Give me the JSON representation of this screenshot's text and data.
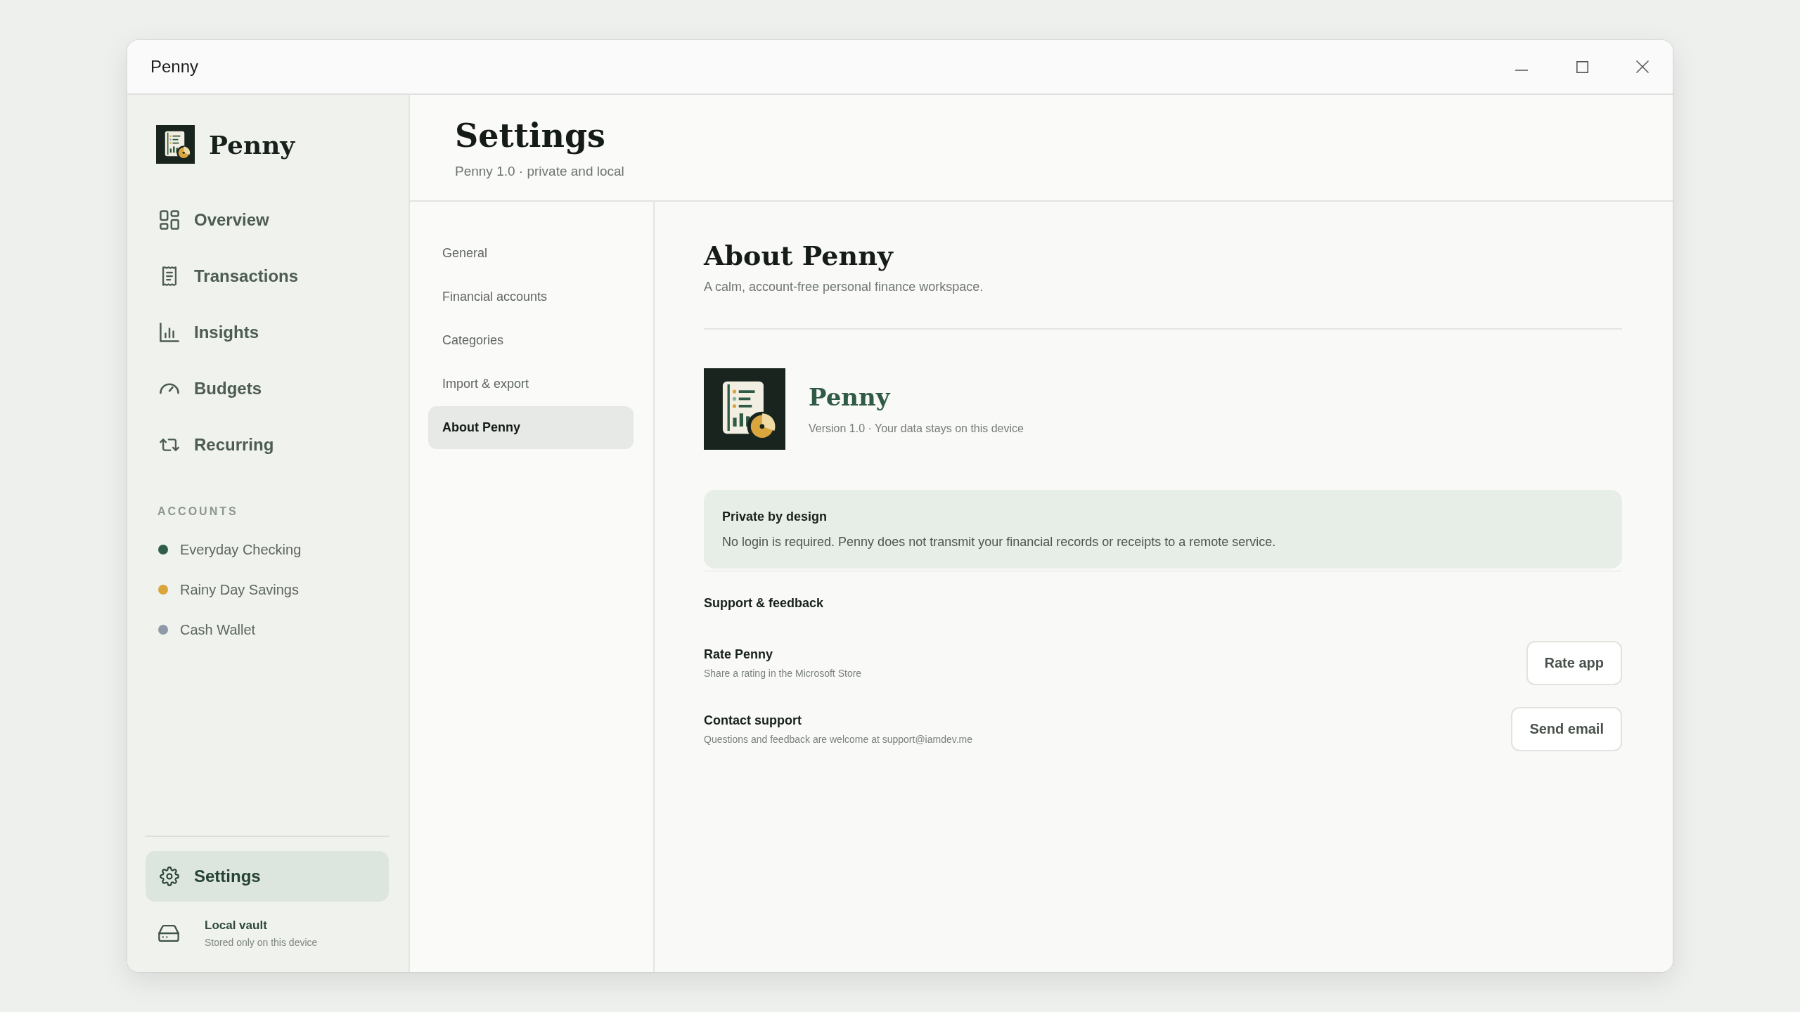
{
  "window": {
    "title": "Penny"
  },
  "sidebar": {
    "brand": "Penny",
    "nav": [
      {
        "label": "Overview",
        "selected": false
      },
      {
        "label": "Transactions",
        "selected": false
      },
      {
        "label": "Insights",
        "selected": false
      },
      {
        "label": "Budgets",
        "selected": false
      },
      {
        "label": "Recurring",
        "selected": false
      }
    ],
    "accounts_heading": "ACCOUNTS",
    "accounts": [
      {
        "name": "Everyday Checking",
        "color": "#2e5e47"
      },
      {
        "name": "Rainy Day Savings",
        "color": "#dba43b"
      },
      {
        "name": "Cash Wallet",
        "color": "#9099a8"
      }
    ],
    "footer_nav": [
      {
        "label": "Settings",
        "selected": true
      }
    ],
    "vault": {
      "title": "Local vault",
      "subtitle": "Stored only on this device"
    }
  },
  "header": {
    "title": "Settings",
    "subtitle": "Penny 1.0 · private and local"
  },
  "settings_nav": [
    {
      "label": "General",
      "selected": false
    },
    {
      "label": "Financial accounts",
      "selected": false
    },
    {
      "label": "Categories",
      "selected": false
    },
    {
      "label": "Import & export",
      "selected": false
    },
    {
      "label": "About Penny",
      "selected": true
    }
  ],
  "about": {
    "title": "About Penny",
    "subtitle": "A calm, account-free personal finance workspace.",
    "app_name": "Penny",
    "app_meta": "Version 1.0 · Your data stays on this device",
    "notice": {
      "title": "Private by design",
      "text": "No login is required. Penny does not transmit your financial records or receipts to a remote service."
    },
    "support_heading": "Support & feedback",
    "rows": [
      {
        "title": "Rate Penny",
        "description": "Share a rating in the Microsoft Store",
        "button": "Rate app"
      },
      {
        "title": "Contact support",
        "description": "Questions and feedback are welcome at support@iamdev.me",
        "button": "Send email"
      }
    ]
  }
}
